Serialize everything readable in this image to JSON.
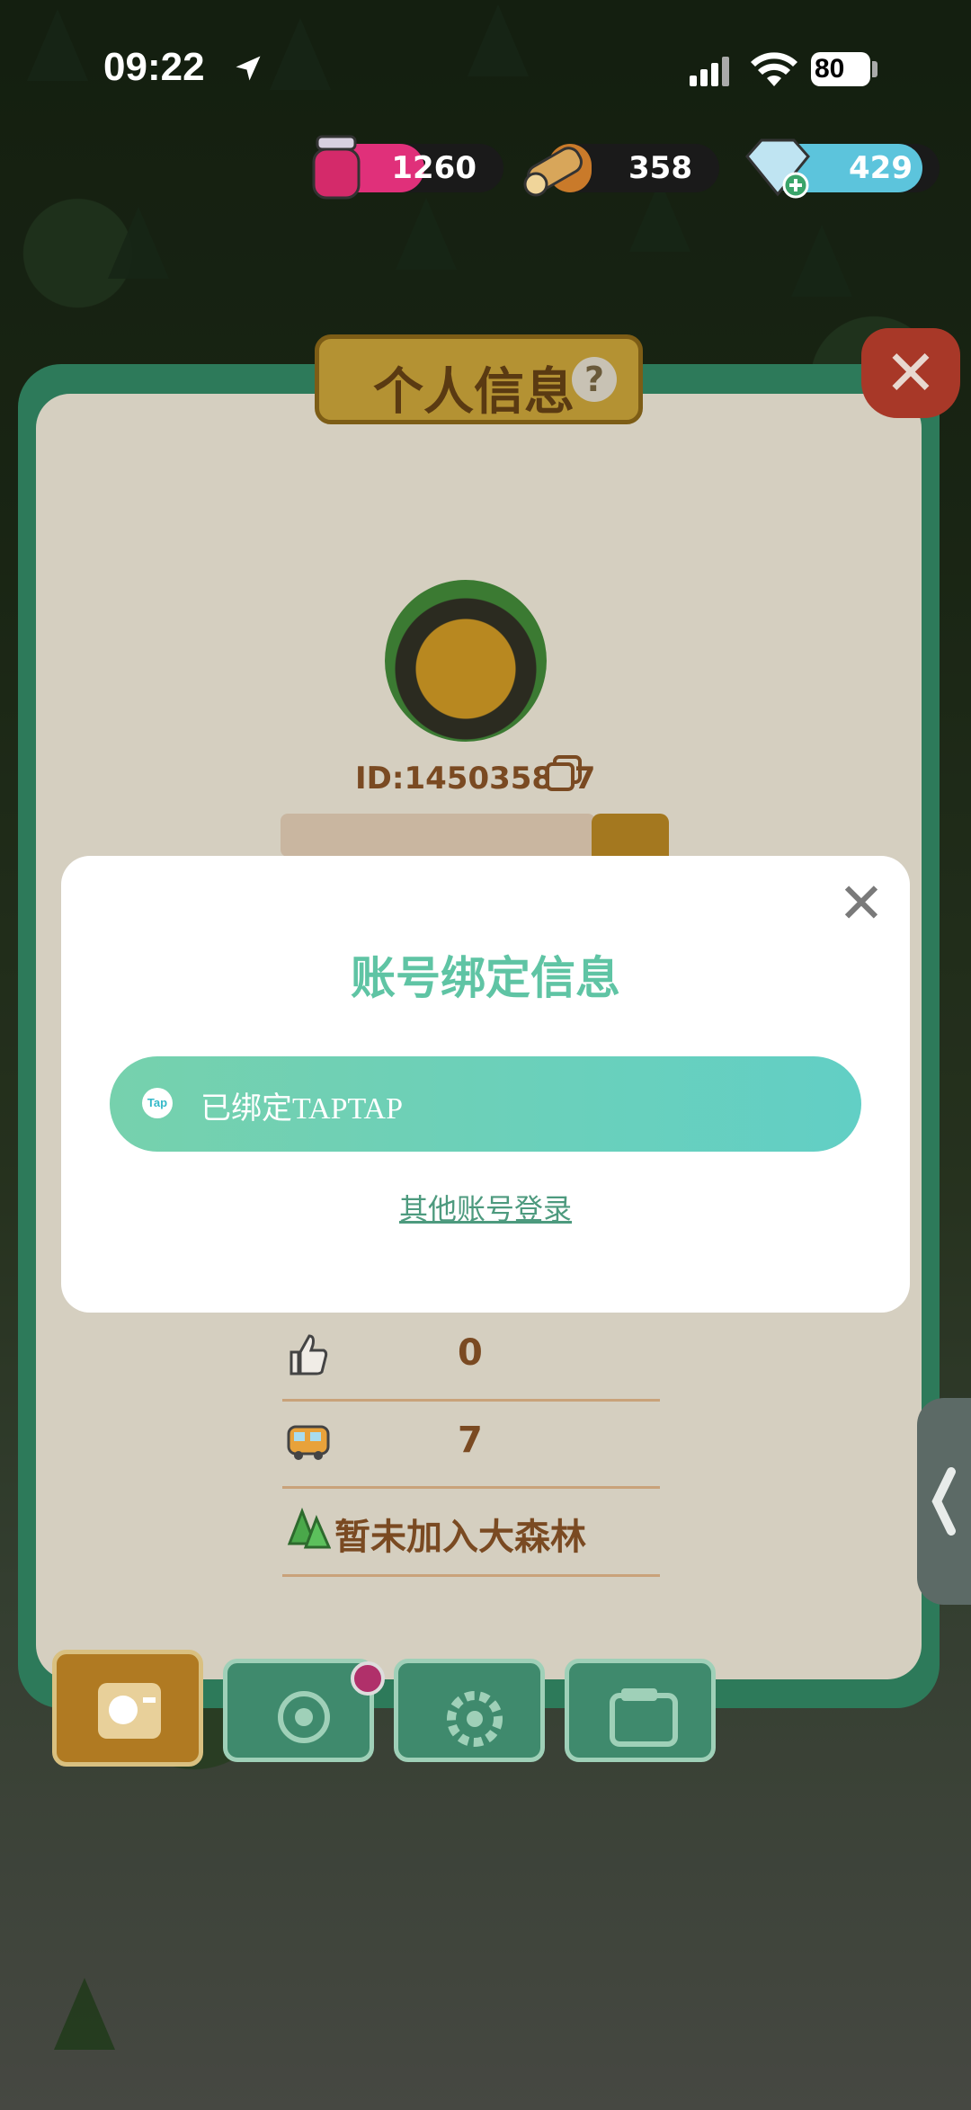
{
  "status_bar": {
    "time": "09:22",
    "battery": "80",
    "icons": [
      "location-arrow-icon",
      "cellular-signal-icon",
      "wifi-icon",
      "battery-icon"
    ]
  },
  "resources": [
    {
      "name": "jam-jar",
      "icon": "jam-jar-icon",
      "value": "1260",
      "color": "#e0307a",
      "fill_fraction": 0.55
    },
    {
      "name": "wood",
      "icon": "wood-log-icon",
      "value": "358",
      "color": "#c97a2a",
      "fill_fraction": 0.25
    },
    {
      "name": "diamond",
      "icon": "diamond-plus-icon",
      "value": "429",
      "color": "#5cc4dc",
      "fill_fraction": 0.9
    }
  ],
  "profile_panel": {
    "title": "个人信息",
    "help_icon": "question-icon",
    "close_icon": "close-icon",
    "player_id": "ID:145035807",
    "copy_icon": "copy-icon",
    "stats": [
      {
        "icon": "thumbs-up-icon",
        "value": "0"
      },
      {
        "icon": "bus-icon",
        "value": "7"
      }
    ],
    "forest_status": "暂未加入大森林",
    "forest_icon": "forest-tree-icon"
  },
  "bottom_tabs": [
    {
      "name": "profile-tab",
      "icon": "profile-card-icon",
      "active": true
    },
    {
      "name": "badge-tab",
      "icon": "flower-badge-icon",
      "active": false,
      "has_notification": true
    },
    {
      "name": "settings-tab",
      "icon": "gear-icon",
      "active": false
    },
    {
      "name": "album-tab",
      "icon": "photo-album-icon",
      "active": false
    }
  ],
  "modal": {
    "title": "账号绑定信息",
    "close_symbol": "✕",
    "bind_icon_text": "Tap",
    "bind_label": "已绑定TAPTAP",
    "other_login": "其他账号登录"
  },
  "colors": {
    "modal_accent": "#5fc4a4",
    "button_gradient_start": "#76d1ad",
    "button_gradient_end": "#62cfc5",
    "panel_frame": "#2d7a5a"
  }
}
